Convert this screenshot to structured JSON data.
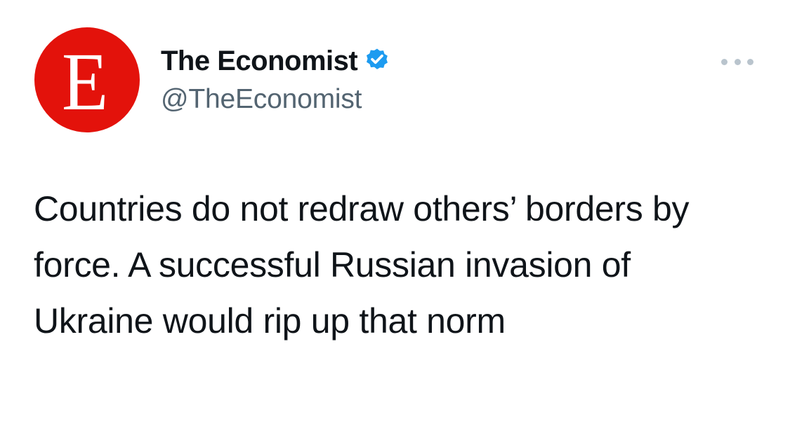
{
  "tweet": {
    "avatar": {
      "letter": "E",
      "background_color": "#e3120b",
      "letter_color": "#ffffff"
    },
    "author": {
      "display_name": "The Economist",
      "handle": "@TheEconomist",
      "verified": true,
      "verified_icon": "verified-badge-icon",
      "verified_color": "#1d9bf0"
    },
    "more_icon": "more-horizontal-icon",
    "text": "Countries do not redraw others’ borders by force. A successful Russian invasion of Ukraine would rip up that norm",
    "colors": {
      "text": "#0f1419",
      "handle": "#536471",
      "more_dots": "#b9c4cd",
      "background": "#ffffff"
    }
  }
}
